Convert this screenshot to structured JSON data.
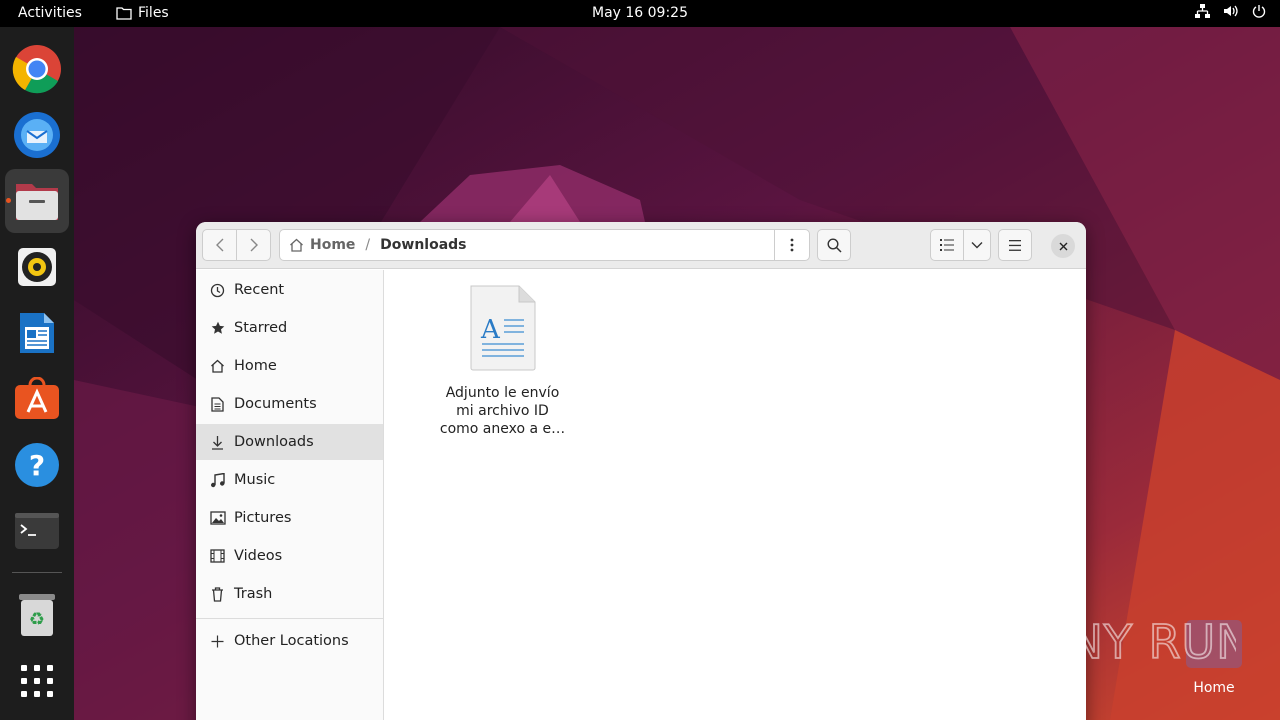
{
  "topbar": {
    "activities": "Activities",
    "app_name": "Files",
    "clock": "May 16  09:25"
  },
  "dock": {
    "items": [
      {
        "name": "chrome-icon"
      },
      {
        "name": "thunderbird-icon"
      },
      {
        "name": "files-icon",
        "active": true
      },
      {
        "name": "rhythmbox-icon"
      },
      {
        "name": "libreoffice-writer-icon"
      },
      {
        "name": "app-center-icon"
      },
      {
        "name": "help-icon"
      },
      {
        "name": "terminal-icon"
      },
      {
        "name": "trash-icon"
      },
      {
        "name": "show-apps-icon"
      }
    ]
  },
  "window": {
    "path": {
      "home": "Home",
      "separator": "/",
      "current": "Downloads"
    },
    "sidebar": {
      "items": [
        {
          "label": "Recent",
          "icon": "clock-icon"
        },
        {
          "label": "Starred",
          "icon": "star-icon"
        },
        {
          "label": "Home",
          "icon": "home-icon"
        },
        {
          "label": "Documents",
          "icon": "document-icon"
        },
        {
          "label": "Downloads",
          "icon": "download-icon",
          "selected": true
        },
        {
          "label": "Music",
          "icon": "music-icon"
        },
        {
          "label": "Pictures",
          "icon": "picture-icon"
        },
        {
          "label": "Videos",
          "icon": "video-icon"
        },
        {
          "label": "Trash",
          "icon": "trash-icon"
        }
      ],
      "other_locations": "Other Locations"
    },
    "files": [
      {
        "name_lines": [
          "Adjunto le envío",
          "mi archivo ID",
          "como anexo a e…"
        ],
        "icon": "text-document-icon"
      }
    ]
  },
  "desktop": {
    "home_label": "Home",
    "watermark": "ANY RUN"
  },
  "colors": {
    "accent": "#e95420",
    "topbar": "#000000",
    "dock": "#1d1d1d"
  }
}
